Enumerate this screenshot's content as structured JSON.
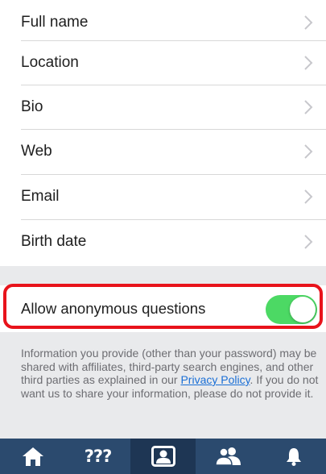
{
  "profile_settings": {
    "rows": [
      {
        "label": "Full name"
      },
      {
        "label": "Location"
      },
      {
        "label": "Bio"
      },
      {
        "label": "Web"
      },
      {
        "label": "Email"
      },
      {
        "label": "Birth date"
      }
    ]
  },
  "anonymous_questions": {
    "label": "Allow anonymous questions",
    "enabled": true,
    "toggle_color": "#4cd964"
  },
  "info": {
    "text_before": "Information you provide (other than your password) may be shared with affiliates, third-party search engines, and other third parties as explained in our ",
    "link_text": "Privacy Policy",
    "text_after": ". If you do not want us to share your information, please do not provide it."
  },
  "tabbar": {
    "background": "#2b4a6e",
    "tabs": [
      {
        "icon": "home-icon",
        "active": false
      },
      {
        "icon": "questions-icon",
        "label": "???",
        "active": false
      },
      {
        "icon": "profile-icon",
        "active": true
      },
      {
        "icon": "friends-icon",
        "active": false
      },
      {
        "icon": "bell-icon",
        "active": false
      }
    ]
  },
  "colors": {
    "highlight": "#e8131b",
    "link": "#1a6fd6"
  }
}
